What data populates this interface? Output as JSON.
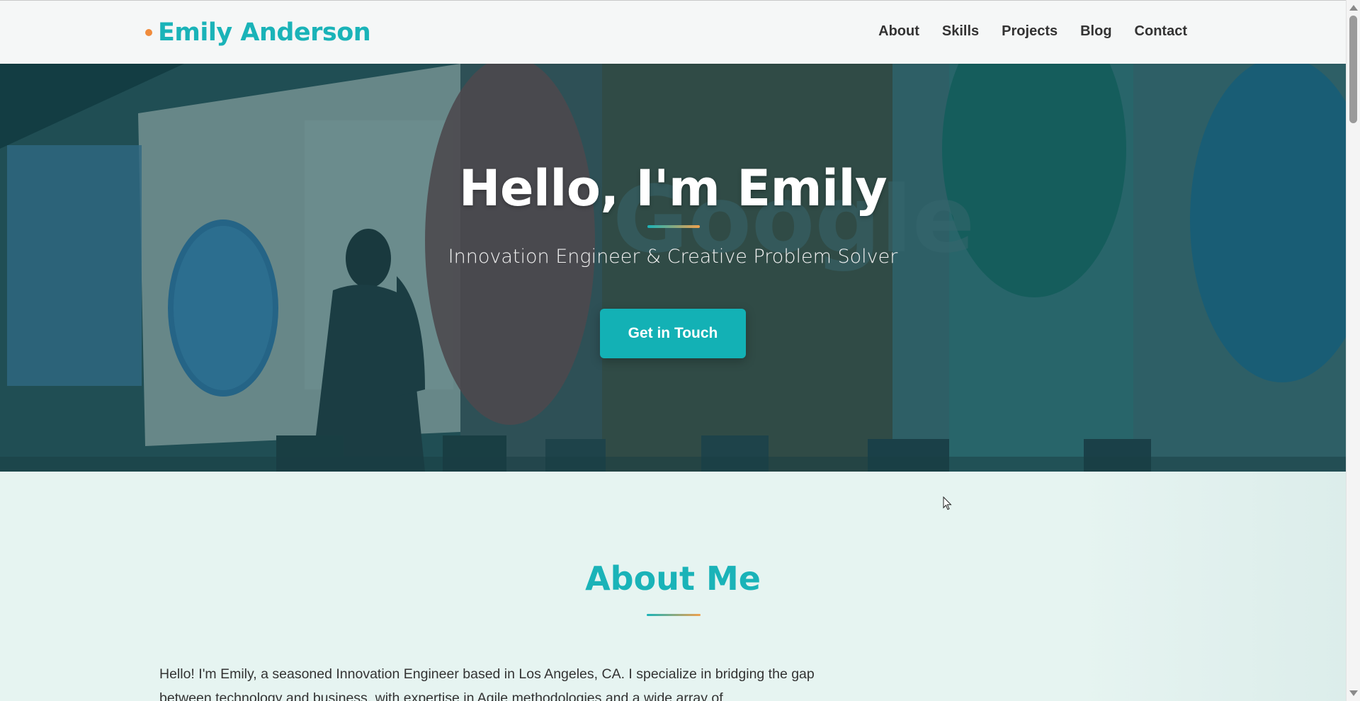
{
  "header": {
    "logo_text": "Emily Anderson",
    "nav": [
      "About",
      "Skills",
      "Projects",
      "Blog",
      "Contact"
    ]
  },
  "hero": {
    "title": "Hello, I'm Emily",
    "subtitle": "Innovation Engineer & Creative Problem Solver",
    "cta_label": "Get in Touch"
  },
  "about": {
    "title": "About Me",
    "paragraph": "Hello! I'm Emily, a seasoned Innovation Engineer based in Los Angeles, CA. I specialize in bridging the gap between technology and business, with expertise in Agile methodologies and a wide array of"
  },
  "colors": {
    "accent": "#1ab3b8",
    "logo_dot": "#f08c3c",
    "button": "#13b1b5"
  },
  "icons": {
    "logo_dot": "dot-icon",
    "cursor": "mouse-pointer-icon"
  }
}
